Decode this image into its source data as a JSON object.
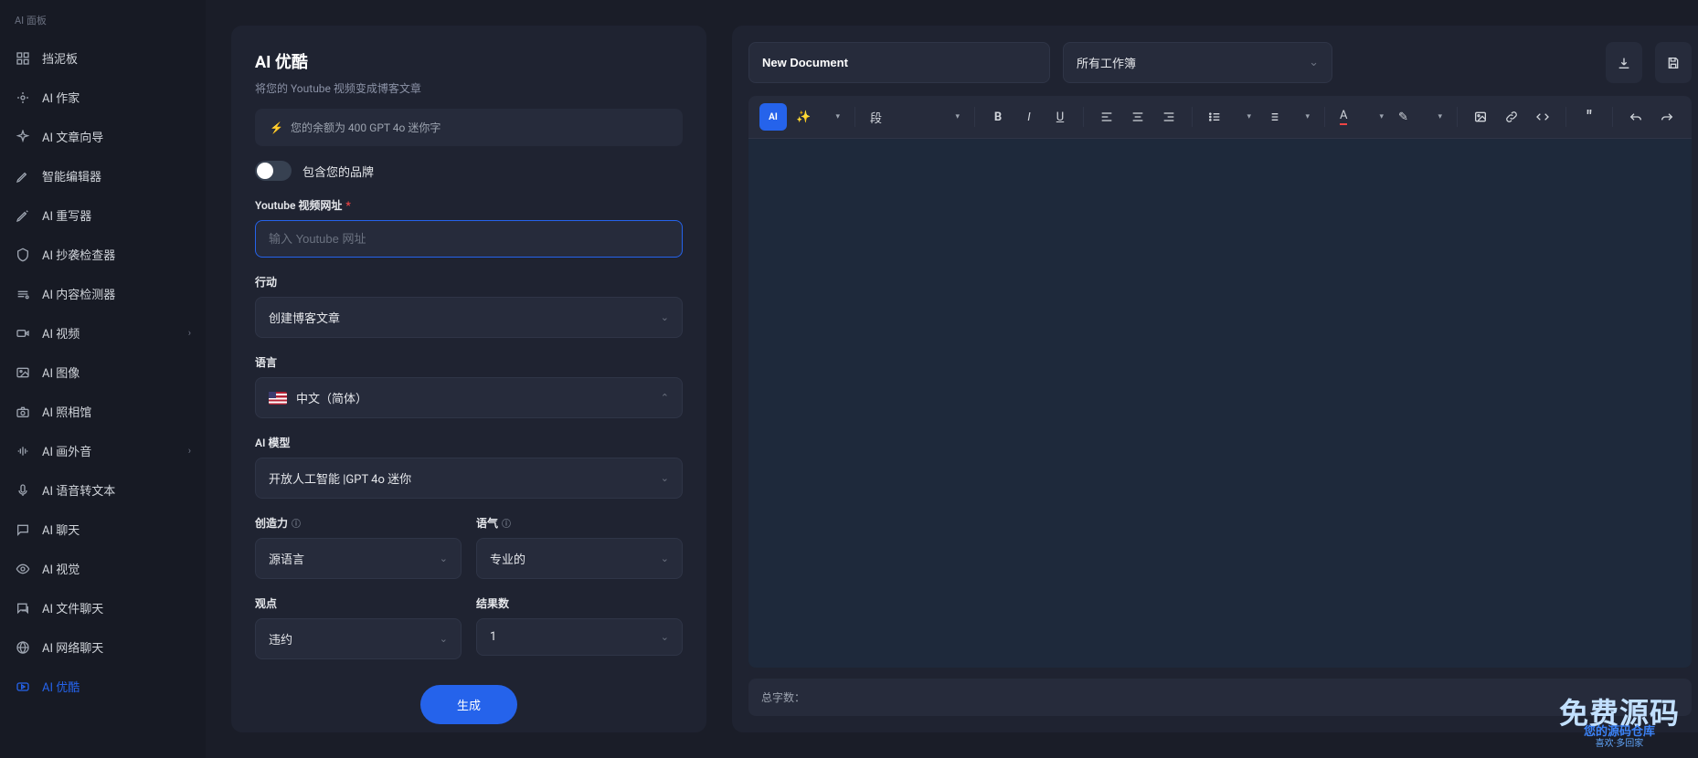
{
  "sidebar": {
    "section": "AI 面板",
    "items": [
      {
        "label": "挡泥板"
      },
      {
        "label": "AI 作家"
      },
      {
        "label": "AI 文章向导"
      },
      {
        "label": "智能编辑器"
      },
      {
        "label": "AI 重写器"
      },
      {
        "label": "AI 抄袭检查器"
      },
      {
        "label": "AI 内容检测器"
      },
      {
        "label": "AI 视频",
        "expandable": true
      },
      {
        "label": "AI 图像"
      },
      {
        "label": "AI 照相馆"
      },
      {
        "label": "AI 画外音",
        "expandable": true
      },
      {
        "label": "AI 语音转文本"
      },
      {
        "label": "AI 聊天"
      },
      {
        "label": "AI 视觉"
      },
      {
        "label": "AI 文件聊天"
      },
      {
        "label": "AI 网络聊天"
      },
      {
        "label": "AI 优酷",
        "active": true
      }
    ]
  },
  "form": {
    "title": "AI 优酷",
    "subtitle": "将您的 Youtube 视频变成博客文章",
    "balance": "您的余额为 400 GPT 4o 迷你字",
    "brand_toggle_label": "包含您的品牌",
    "url_label": "Youtube 视频网址",
    "url_placeholder": "输入 Youtube 网址",
    "action_label": "行动",
    "action_value": "创建博客文章",
    "lang_label": "语言",
    "lang_value": "中文（简体）",
    "model_label": "AI 模型",
    "model_value": "开放人工智能 |GPT 4o 迷你",
    "creativity_label": "创造力",
    "creativity_value": "源语言",
    "tone_label": "语气",
    "tone_value": "专业的",
    "pov_label": "观点",
    "pov_value": "违约",
    "results_label": "结果数",
    "results_value": "1",
    "submit": "生成"
  },
  "editor": {
    "doc_name": "New Document",
    "workbook": "所有工作簿",
    "ai_badge": "AI",
    "para_label": "段",
    "wordcount_label": "总字数：",
    "wordcount_value": ""
  },
  "watermark": {
    "line1": "免费源码",
    "line2": "您的源码仓库",
    "line3": "喜欢·多回家"
  }
}
